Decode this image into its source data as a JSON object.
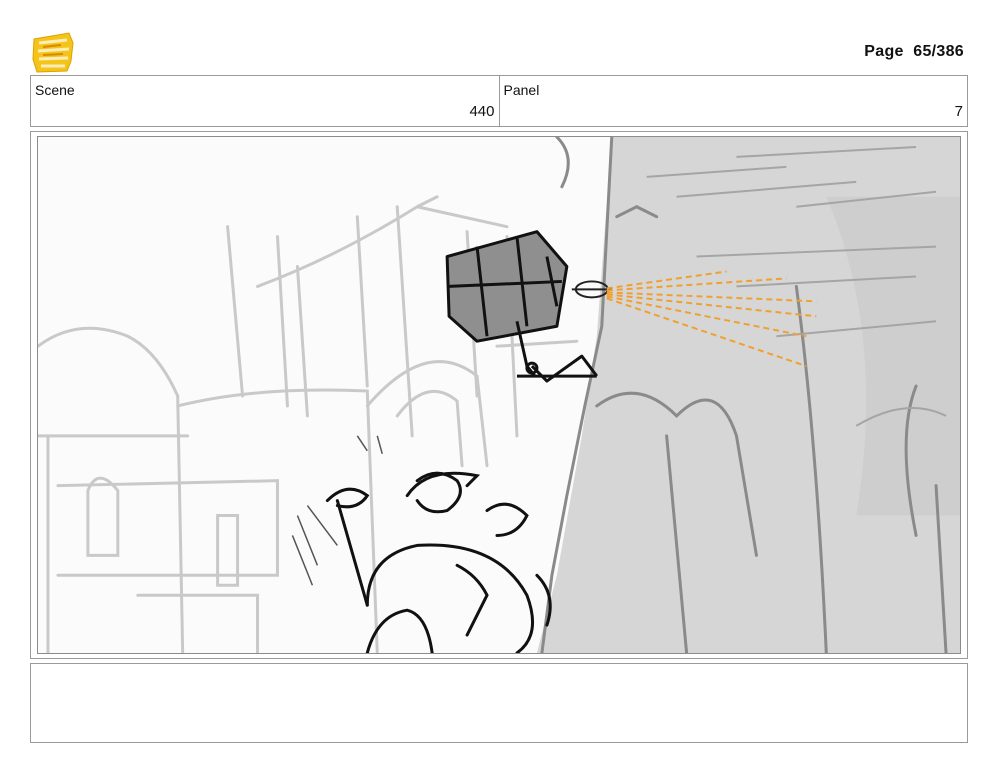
{
  "header": {
    "logo_icon": "young-jedi-adventures-logo",
    "page_label": "Page",
    "page_number": "65/386"
  },
  "info_row": {
    "scene_label": "Scene",
    "scene_value": "440",
    "panel_label": "Panel",
    "panel_value": "7"
  },
  "panel": {
    "illustration": "storyboard-sketch"
  },
  "notes": {
    "text": ""
  },
  "colors": {
    "border": "#9a9a9a",
    "logo_yellow": "#f5c41a",
    "laser_orange": "#f0a030",
    "sketch_gray": "#c9c9c9"
  }
}
